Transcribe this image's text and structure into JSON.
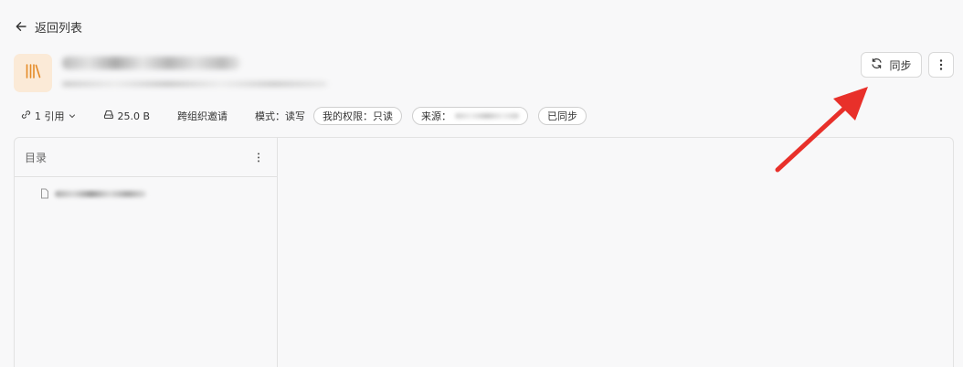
{
  "header": {
    "back_label": "返回列表"
  },
  "knowledge_base": {
    "icon": "library-icon",
    "accent": "#e58a27",
    "icon_bg": "#fbead7"
  },
  "actions": {
    "sync_label": "同步",
    "more": "more-vertical-icon"
  },
  "meta": {
    "references": "1 引用",
    "size": "25.0 B",
    "invite": "跨组织邀请",
    "mode": "模式：读写",
    "permission": "我的权限：只读",
    "source_label": "来源：",
    "sync_status": "已同步"
  },
  "toc": {
    "title": "目录"
  },
  "annotation": {
    "arrow_color": "#e8302a"
  }
}
